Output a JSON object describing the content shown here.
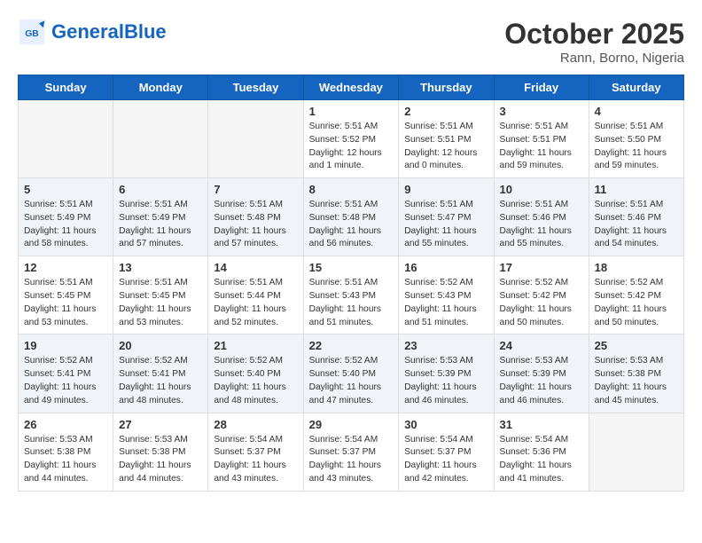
{
  "header": {
    "logo_general": "General",
    "logo_blue": "Blue",
    "month_year": "October 2025",
    "location": "Rann, Borno, Nigeria"
  },
  "weekdays": [
    "Sunday",
    "Monday",
    "Tuesday",
    "Wednesday",
    "Thursday",
    "Friday",
    "Saturday"
  ],
  "weeks": [
    [
      {
        "day": "",
        "text": ""
      },
      {
        "day": "",
        "text": ""
      },
      {
        "day": "",
        "text": ""
      },
      {
        "day": "1",
        "text": "Sunrise: 5:51 AM\nSunset: 5:52 PM\nDaylight: 12 hours\nand 1 minute."
      },
      {
        "day": "2",
        "text": "Sunrise: 5:51 AM\nSunset: 5:51 PM\nDaylight: 12 hours\nand 0 minutes."
      },
      {
        "day": "3",
        "text": "Sunrise: 5:51 AM\nSunset: 5:51 PM\nDaylight: 11 hours\nand 59 minutes."
      },
      {
        "day": "4",
        "text": "Sunrise: 5:51 AM\nSunset: 5:50 PM\nDaylight: 11 hours\nand 59 minutes."
      }
    ],
    [
      {
        "day": "5",
        "text": "Sunrise: 5:51 AM\nSunset: 5:49 PM\nDaylight: 11 hours\nand 58 minutes."
      },
      {
        "day": "6",
        "text": "Sunrise: 5:51 AM\nSunset: 5:49 PM\nDaylight: 11 hours\nand 57 minutes."
      },
      {
        "day": "7",
        "text": "Sunrise: 5:51 AM\nSunset: 5:48 PM\nDaylight: 11 hours\nand 57 minutes."
      },
      {
        "day": "8",
        "text": "Sunrise: 5:51 AM\nSunset: 5:48 PM\nDaylight: 11 hours\nand 56 minutes."
      },
      {
        "day": "9",
        "text": "Sunrise: 5:51 AM\nSunset: 5:47 PM\nDaylight: 11 hours\nand 55 minutes."
      },
      {
        "day": "10",
        "text": "Sunrise: 5:51 AM\nSunset: 5:46 PM\nDaylight: 11 hours\nand 55 minutes."
      },
      {
        "day": "11",
        "text": "Sunrise: 5:51 AM\nSunset: 5:46 PM\nDaylight: 11 hours\nand 54 minutes."
      }
    ],
    [
      {
        "day": "12",
        "text": "Sunrise: 5:51 AM\nSunset: 5:45 PM\nDaylight: 11 hours\nand 53 minutes."
      },
      {
        "day": "13",
        "text": "Sunrise: 5:51 AM\nSunset: 5:45 PM\nDaylight: 11 hours\nand 53 minutes."
      },
      {
        "day": "14",
        "text": "Sunrise: 5:51 AM\nSunset: 5:44 PM\nDaylight: 11 hours\nand 52 minutes."
      },
      {
        "day": "15",
        "text": "Sunrise: 5:51 AM\nSunset: 5:43 PM\nDaylight: 11 hours\nand 51 minutes."
      },
      {
        "day": "16",
        "text": "Sunrise: 5:52 AM\nSunset: 5:43 PM\nDaylight: 11 hours\nand 51 minutes."
      },
      {
        "day": "17",
        "text": "Sunrise: 5:52 AM\nSunset: 5:42 PM\nDaylight: 11 hours\nand 50 minutes."
      },
      {
        "day": "18",
        "text": "Sunrise: 5:52 AM\nSunset: 5:42 PM\nDaylight: 11 hours\nand 50 minutes."
      }
    ],
    [
      {
        "day": "19",
        "text": "Sunrise: 5:52 AM\nSunset: 5:41 PM\nDaylight: 11 hours\nand 49 minutes."
      },
      {
        "day": "20",
        "text": "Sunrise: 5:52 AM\nSunset: 5:41 PM\nDaylight: 11 hours\nand 48 minutes."
      },
      {
        "day": "21",
        "text": "Sunrise: 5:52 AM\nSunset: 5:40 PM\nDaylight: 11 hours\nand 48 minutes."
      },
      {
        "day": "22",
        "text": "Sunrise: 5:52 AM\nSunset: 5:40 PM\nDaylight: 11 hours\nand 47 minutes."
      },
      {
        "day": "23",
        "text": "Sunrise: 5:53 AM\nSunset: 5:39 PM\nDaylight: 11 hours\nand 46 minutes."
      },
      {
        "day": "24",
        "text": "Sunrise: 5:53 AM\nSunset: 5:39 PM\nDaylight: 11 hours\nand 46 minutes."
      },
      {
        "day": "25",
        "text": "Sunrise: 5:53 AM\nSunset: 5:38 PM\nDaylight: 11 hours\nand 45 minutes."
      }
    ],
    [
      {
        "day": "26",
        "text": "Sunrise: 5:53 AM\nSunset: 5:38 PM\nDaylight: 11 hours\nand 44 minutes."
      },
      {
        "day": "27",
        "text": "Sunrise: 5:53 AM\nSunset: 5:38 PM\nDaylight: 11 hours\nand 44 minutes."
      },
      {
        "day": "28",
        "text": "Sunrise: 5:54 AM\nSunset: 5:37 PM\nDaylight: 11 hours\nand 43 minutes."
      },
      {
        "day": "29",
        "text": "Sunrise: 5:54 AM\nSunset: 5:37 PM\nDaylight: 11 hours\nand 43 minutes."
      },
      {
        "day": "30",
        "text": "Sunrise: 5:54 AM\nSunset: 5:37 PM\nDaylight: 11 hours\nand 42 minutes."
      },
      {
        "day": "31",
        "text": "Sunrise: 5:54 AM\nSunset: 5:36 PM\nDaylight: 11 hours\nand 41 minutes."
      },
      {
        "day": "",
        "text": ""
      }
    ]
  ]
}
